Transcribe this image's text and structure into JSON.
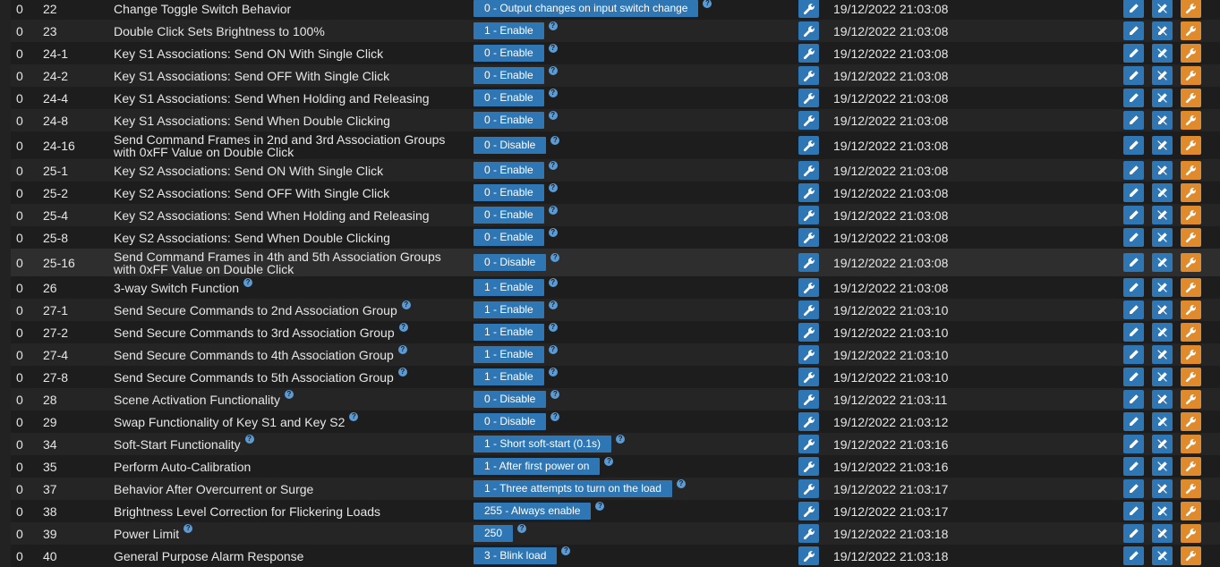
{
  "rows": [
    {
      "instance": "0",
      "param": "22",
      "label": "Change Toggle Switch Behavior",
      "label_help": false,
      "value": "0 - Output changes on input switch change",
      "timestamp": "19/12/2022 21:03:08"
    },
    {
      "instance": "0",
      "param": "23",
      "label": "Double Click Sets Brightness to 100%",
      "label_help": false,
      "value": "1 - Enable",
      "timestamp": "19/12/2022 21:03:08"
    },
    {
      "instance": "0",
      "param": "24-1",
      "label": "Key S1 Associations: Send ON With Single Click",
      "label_help": false,
      "value": "0 - Enable",
      "timestamp": "19/12/2022 21:03:08"
    },
    {
      "instance": "0",
      "param": "24-2",
      "label": "Key S1 Associations: Send OFF With Single Click",
      "label_help": false,
      "value": "0 - Enable",
      "timestamp": "19/12/2022 21:03:08"
    },
    {
      "instance": "0",
      "param": "24-4",
      "label": "Key S1 Associations: Send When Holding and Releasing",
      "label_help": false,
      "value": "0 - Enable",
      "timestamp": "19/12/2022 21:03:08"
    },
    {
      "instance": "0",
      "param": "24-8",
      "label": "Key S1 Associations: Send When Double Clicking",
      "label_help": false,
      "value": "0 - Enable",
      "timestamp": "19/12/2022 21:03:08"
    },
    {
      "instance": "0",
      "param": "24-16",
      "label": "Send Command Frames in 2nd and 3rd Association Groups with 0xFF Value on Double Click",
      "label_help": false,
      "value": "0 - Disable",
      "timestamp": "19/12/2022 21:03:08",
      "tall": true
    },
    {
      "instance": "0",
      "param": "25-1",
      "label": "Key S2 Associations: Send ON With Single Click",
      "label_help": false,
      "value": "0 - Enable",
      "timestamp": "19/12/2022 21:03:08"
    },
    {
      "instance": "0",
      "param": "25-2",
      "label": "Key S2 Associations: Send OFF With Single Click",
      "label_help": false,
      "value": "0 - Enable",
      "timestamp": "19/12/2022 21:03:08"
    },
    {
      "instance": "0",
      "param": "25-4",
      "label": "Key S2 Associations: Send When Holding and Releasing",
      "label_help": false,
      "value": "0 - Enable",
      "timestamp": "19/12/2022 21:03:08"
    },
    {
      "instance": "0",
      "param": "25-8",
      "label": "Key S2 Associations: Send When Double Clicking",
      "label_help": false,
      "value": "0 - Enable",
      "timestamp": "19/12/2022 21:03:08"
    },
    {
      "instance": "0",
      "param": "25-16",
      "label": "Send Command Frames in 4th and 5th Association Groups with 0xFF Value on Double Click",
      "label_help": false,
      "value": "0 - Disable",
      "timestamp": "19/12/2022 21:03:08",
      "tall": true,
      "highlight": true
    },
    {
      "instance": "0",
      "param": "26",
      "label": "3-way Switch Function",
      "label_help": true,
      "value": "1 - Enable",
      "timestamp": "19/12/2022 21:03:08"
    },
    {
      "instance": "0",
      "param": "27-1",
      "label": "Send Secure Commands to 2nd Association Group",
      "label_help": true,
      "value": "1 - Enable",
      "timestamp": "19/12/2022 21:03:10"
    },
    {
      "instance": "0",
      "param": "27-2",
      "label": "Send Secure Commands to 3rd Association Group",
      "label_help": true,
      "value": "1 - Enable",
      "timestamp": "19/12/2022 21:03:10"
    },
    {
      "instance": "0",
      "param": "27-4",
      "label": "Send Secure Commands to 4th Association Group",
      "label_help": true,
      "value": "1 - Enable",
      "timestamp": "19/12/2022 21:03:10"
    },
    {
      "instance": "0",
      "param": "27-8",
      "label": "Send Secure Commands to 5th Association Group",
      "label_help": true,
      "value": "1 - Enable",
      "timestamp": "19/12/2022 21:03:10"
    },
    {
      "instance": "0",
      "param": "28",
      "label": "Scene Activation Functionality",
      "label_help": true,
      "value": "0 - Disable",
      "timestamp": "19/12/2022 21:03:11"
    },
    {
      "instance": "0",
      "param": "29",
      "label": "Swap Functionality of Key S1 and Key S2",
      "label_help": true,
      "value": "0 - Disable",
      "timestamp": "19/12/2022 21:03:12"
    },
    {
      "instance": "0",
      "param": "34",
      "label": "Soft-Start Functionality",
      "label_help": true,
      "value": "1 - Short soft-start (0.1s)",
      "timestamp": "19/12/2022 21:03:16"
    },
    {
      "instance": "0",
      "param": "35",
      "label": "Perform Auto-Calibration",
      "label_help": false,
      "value": "1 - After first power on",
      "timestamp": "19/12/2022 21:03:16"
    },
    {
      "instance": "0",
      "param": "37",
      "label": "Behavior After Overcurrent or Surge",
      "label_help": false,
      "value": "1 - Three attempts to turn on the load",
      "timestamp": "19/12/2022 21:03:17"
    },
    {
      "instance": "0",
      "param": "38",
      "label": "Brightness Level Correction for Flickering Loads",
      "label_help": false,
      "value": "255 - Always enable",
      "timestamp": "19/12/2022 21:03:17"
    },
    {
      "instance": "0",
      "param": "39",
      "label": "Power Limit",
      "label_help": true,
      "value": "250",
      "timestamp": "19/12/2022 21:03:18"
    },
    {
      "instance": "0",
      "param": "40",
      "label": "General Purpose Alarm Response",
      "label_help": false,
      "value": "3 - Blink load",
      "timestamp": "19/12/2022 21:03:18"
    }
  ],
  "help_glyph": "?",
  "icons": {
    "configure": "wrench-icon",
    "edit": "pencil-icon",
    "edit_alt": "pencil-icon",
    "apply": "wrench-icon"
  },
  "colors": {
    "background": "#222222",
    "row_odd": "#1d1d1d",
    "row_even": "#252525",
    "accent_blue": "#2f76b5",
    "accent_orange": "#e08a2e",
    "help_blue": "#5b9bd5"
  }
}
